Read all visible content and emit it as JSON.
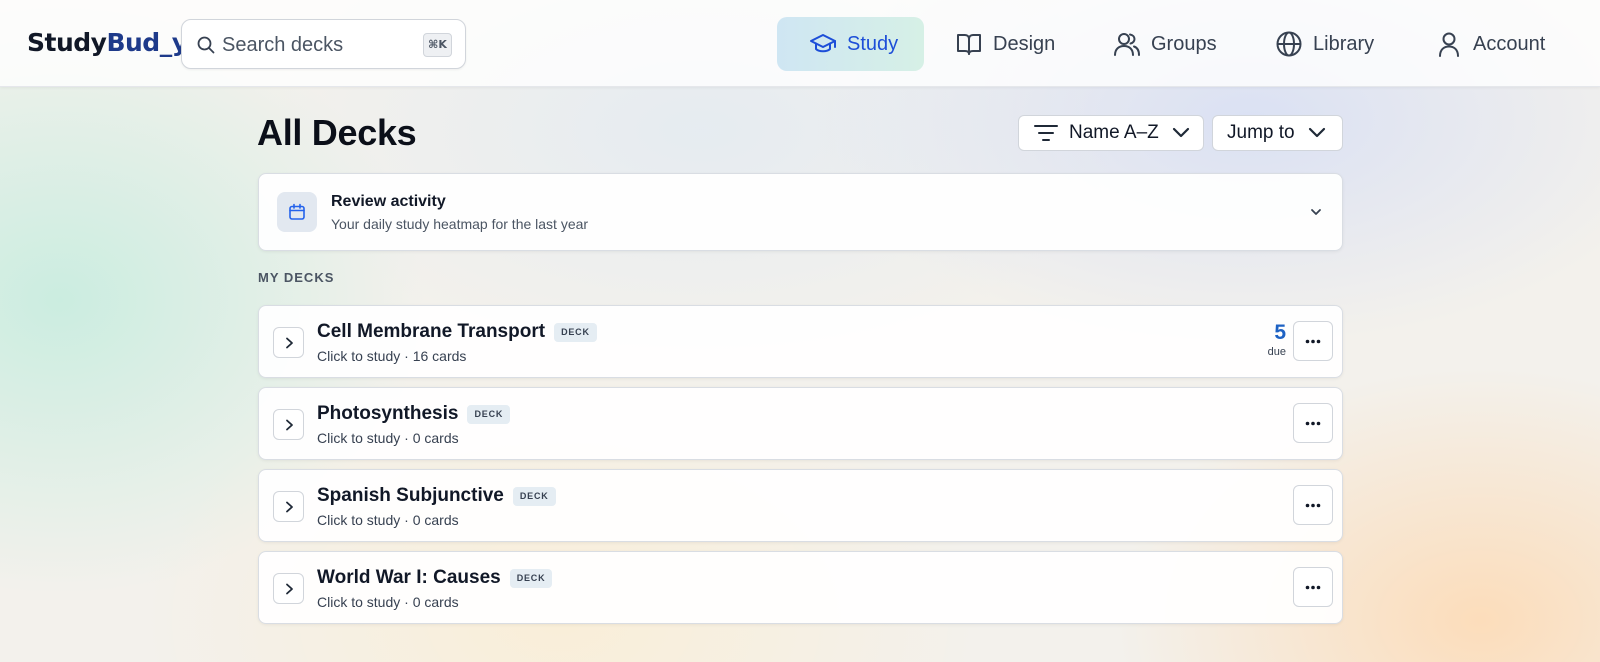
{
  "header": {
    "logo_part1": "Study",
    "logo_part2": "Bud_y",
    "search_placeholder": "Search decks",
    "search_shortcut": "⌘K",
    "nav": [
      {
        "label": "Study",
        "icon": "graduation-cap-icon",
        "active": true
      },
      {
        "label": "Design",
        "icon": "open-book-icon",
        "active": false
      },
      {
        "label": "Groups",
        "icon": "users-icon",
        "active": false
      },
      {
        "label": "Library",
        "icon": "globe-icon",
        "active": false
      },
      {
        "label": "Account",
        "icon": "user-icon",
        "active": false
      }
    ]
  },
  "main": {
    "title": "All Decks",
    "sort_label": "Name A–Z",
    "jump_label": "Jump to",
    "activity": {
      "title": "Review activity",
      "subtitle": "Your daily study heatmap for the last year"
    },
    "section_label": "MY DECKS",
    "decks": [
      {
        "name": "Cell Membrane Transport",
        "badge": "DECK",
        "meta": "Click to study · 16 cards",
        "due_count": "5",
        "due_label": "due"
      },
      {
        "name": "Photosynthesis",
        "badge": "DECK",
        "meta": "Click to study · 0 cards"
      },
      {
        "name": "Spanish Subjunctive",
        "badge": "DECK",
        "meta": "Click to study · 0 cards"
      },
      {
        "name": "World War I: Causes",
        "badge": "DECK",
        "meta": "Click to study · 0 cards"
      }
    ]
  },
  "colors": {
    "accent": "#1d4ed8",
    "due": "#1d62c4",
    "logo_accent": "#1e3a8a"
  }
}
